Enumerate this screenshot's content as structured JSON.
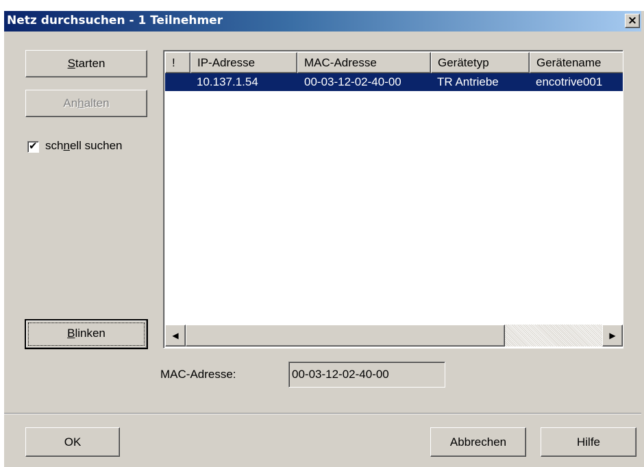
{
  "window": {
    "title": "Netz durchsuchen - 1 Teilnehmer",
    "close_glyph": "×"
  },
  "left_panel": {
    "start_prefix": "",
    "start_mnemonic": "S",
    "start_suffix": "tarten",
    "stop_prefix": "An",
    "stop_mnemonic": "h",
    "stop_suffix": "alten",
    "fast_search": {
      "checked": true,
      "check_glyph": "✔",
      "label_prefix": "sch",
      "label_mnemonic": "n",
      "label_suffix": "ell suchen"
    },
    "blink_prefix": "",
    "blink_mnemonic": "B",
    "blink_suffix": "linken"
  },
  "list": {
    "columns": [
      "!",
      "IP-Adresse",
      "MAC-Adresse",
      "Gerätetyp",
      "Gerätename"
    ],
    "rows": [
      {
        "flag": "",
        "ip": "10.137.1.54",
        "mac": "00-03-12-02-40-00",
        "type": "TR Antriebe",
        "name": "encotrive001",
        "selected": true
      }
    ],
    "scroll_left_glyph": "◀",
    "scroll_right_glyph": "▶"
  },
  "mac_detail": {
    "label": "MAC-Adresse:",
    "value": "00-03-12-02-40-00"
  },
  "footer": {
    "ok_label": "OK",
    "cancel_label": "Abbrechen",
    "help_label": "Hilfe"
  },
  "colors": {
    "title_gradient_start": "#0a246a",
    "title_gradient_end": "#a6caf0",
    "dialog_face": "#d4d0c8",
    "selection": "#0a246a"
  }
}
